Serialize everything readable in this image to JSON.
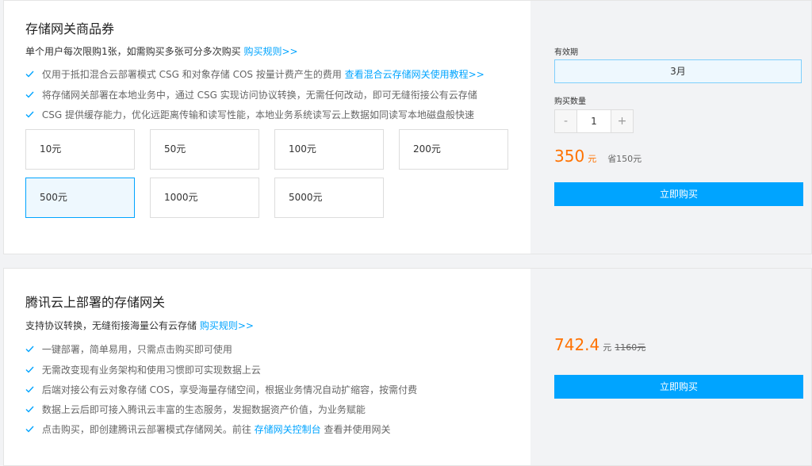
{
  "card1": {
    "title": "存储网关商品券",
    "subtitle": "单个用户每次限购1张，如需购买多张可分多次购买",
    "rule_link": "购买规则>>",
    "features": [
      {
        "text": "仅用于抵扣混合云部署模式 CSG 和对象存储 COS 按量计费产生的费用",
        "link": "查看混合云存储网关使用教程>>"
      },
      {
        "text": "将存储网关部署在本地业务中，通过 CSG 实现访问协议转换，无需任何改动，即可无缝衔接公有云存储",
        "link": ""
      },
      {
        "text": "CSG 提供缓存能力，优化远距离传输和读写性能，本地业务系统读写云上数据如同读写本地磁盘般快速",
        "link": ""
      }
    ],
    "options": [
      "10元",
      "50元",
      "100元",
      "200元",
      "500元",
      "1000元",
      "5000元"
    ],
    "selected_option": "500元",
    "period_label": "有效期",
    "period_value": "3月",
    "quantity_label": "购买数量",
    "quantity_minus": "-",
    "quantity_value": "1",
    "quantity_plus": "+",
    "price": "350",
    "price_unit": "元",
    "price_save": "省150元",
    "buy_label": "立即购买"
  },
  "card2": {
    "title": "腾讯云上部署的存储网关",
    "subtitle": "支持协议转换，无缝衔接海量公有云存储",
    "rule_link": "购买规则>>",
    "features": [
      {
        "text": "一键部署，简单易用，只需点击购买即可使用",
        "link": "",
        "suffix": ""
      },
      {
        "text": "无需改变现有业务架构和使用习惯即可实现数据上云",
        "link": "",
        "suffix": ""
      },
      {
        "text": "后端对接公有云对象存储 COS，享受海量存储空间，根据业务情况自动扩缩容，按需付费",
        "link": "",
        "suffix": ""
      },
      {
        "text": "数据上云后即可接入腾讯云丰富的生态服务，发掘数据资产价值，为业务赋能",
        "link": "",
        "suffix": ""
      },
      {
        "text": "点击购买，即创建腾讯云部署模式存储网关。前往",
        "link": "存储网关控制台",
        "suffix": "查看并使用网关"
      }
    ],
    "price": "742.4",
    "price_unit": "元",
    "price_original": "1160元",
    "buy_label": "立即购买"
  },
  "colors": {
    "accent": "#00a4ff",
    "price": "#ff7200",
    "check": "#00a4ff"
  },
  "icons": {
    "feature_bullet": "check-icon"
  }
}
